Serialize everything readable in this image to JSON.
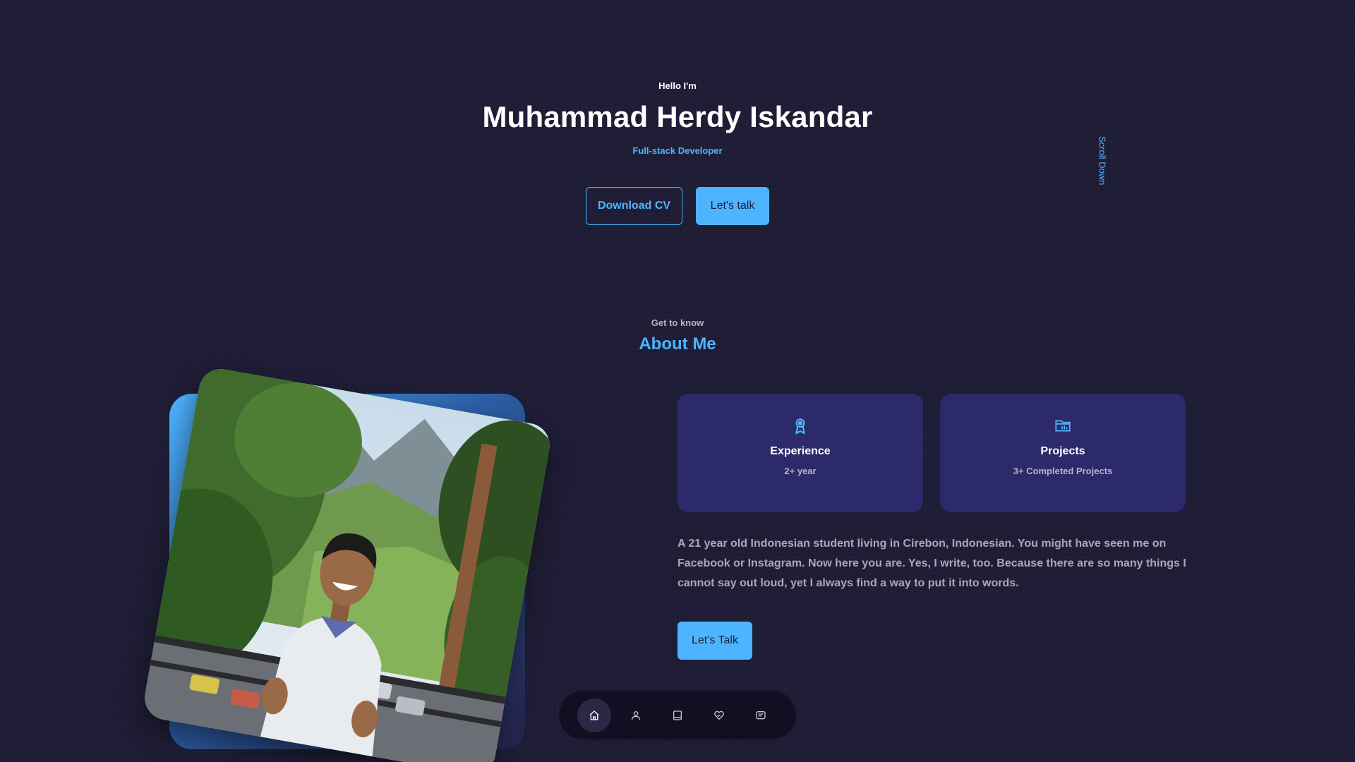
{
  "hero": {
    "greeting": "Hello I'm",
    "name": "Muhammad Herdy Iskandar",
    "role": "Full-stack Developer",
    "download_cv_label": "Download CV",
    "lets_talk_label": "Let's talk"
  },
  "scroll_down": "Scroll Down",
  "about": {
    "kicker": "Get to know",
    "title": "About Me",
    "cards": [
      {
        "icon": "award-icon",
        "title": "Experience",
        "subtitle": "2+ year"
      },
      {
        "icon": "folder-icon",
        "title": "Projects",
        "subtitle": "3+ Completed Projects"
      }
    ],
    "description": "A 21 year old Indonesian student living in Cirebon, Indonesian. You might have seen me on Facebook or Instagram. Now here you are. Yes, I write, too. Because there are so many things I cannot say out loud, yet I always find a way to put it into words.",
    "cta_label": "Let's Talk"
  },
  "nav": {
    "items": [
      {
        "icon": "home-icon",
        "active": true
      },
      {
        "icon": "user-icon",
        "active": false
      },
      {
        "icon": "book-icon",
        "active": false
      },
      {
        "icon": "services-icon",
        "active": false
      },
      {
        "icon": "message-icon",
        "active": false
      }
    ]
  },
  "colors": {
    "background": "#1f1d36",
    "accent": "#4db5ff",
    "card": "#2c2a6a",
    "muted_text": "#a8a8bb"
  }
}
